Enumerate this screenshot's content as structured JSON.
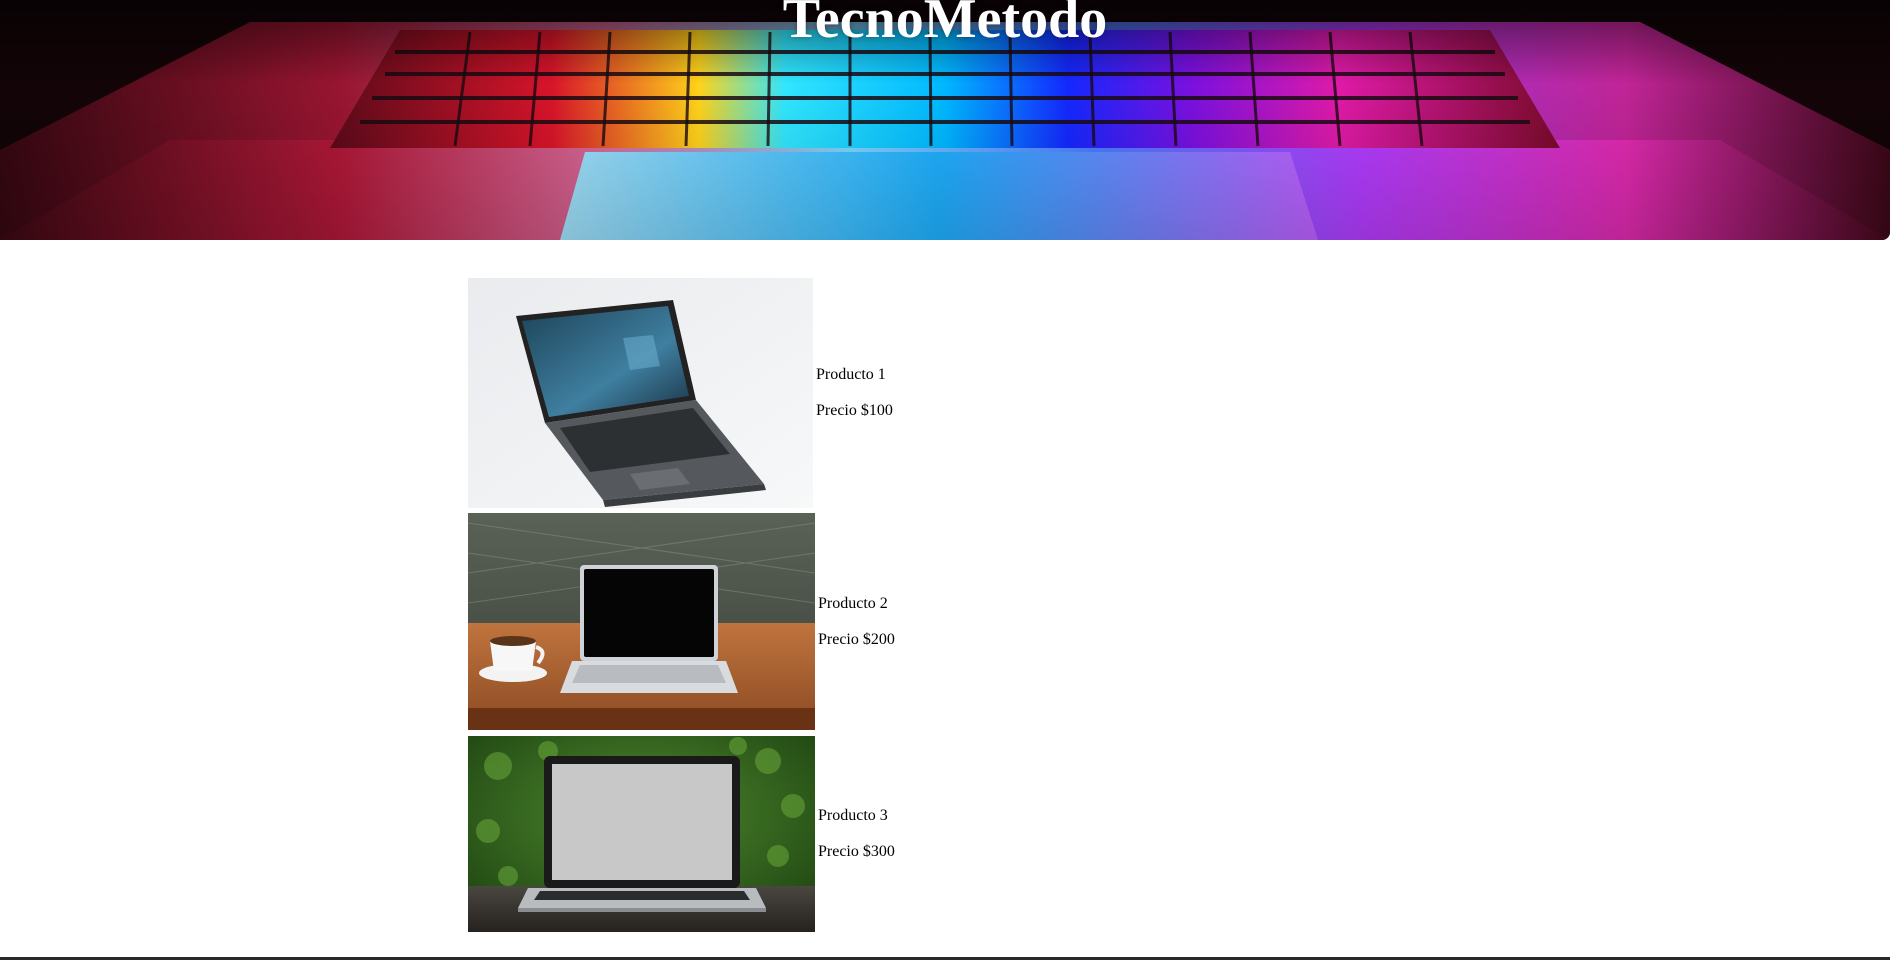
{
  "header": {
    "title": "TecnoMetodo"
  },
  "products": [
    {
      "name": "Producto 1",
      "price": "Precio $100"
    },
    {
      "name": "Producto 2",
      "price": "Precio $200"
    },
    {
      "name": "Producto 3",
      "price": "Precio $300"
    }
  ],
  "colors": {
    "background": "#ffffff",
    "title": "#ffffff",
    "text": "#000000"
  }
}
